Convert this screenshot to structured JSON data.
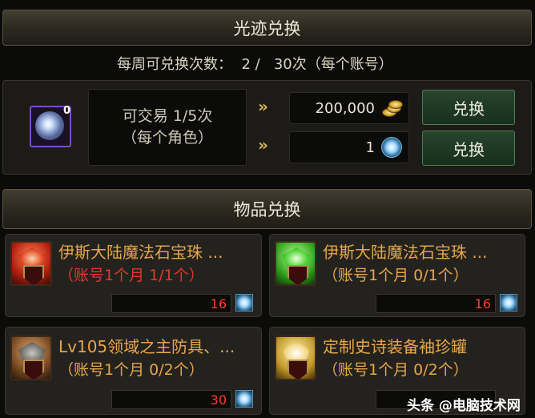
{
  "light_exchange": {
    "title": "光迹兑换",
    "weekly_limit": "每周可兑换次数：  2 /   30次（每个账号）",
    "item_badge": "0",
    "tradable_line1": "可交易 1/5次",
    "tradable_line2": "（每个角色）",
    "costs": [
      {
        "amount": "200,000",
        "currency_icon": "gold-coin-icon",
        "button": "兑换"
      },
      {
        "amount": "1",
        "currency_icon": "light-orb-icon",
        "button": "兑换"
      }
    ]
  },
  "item_exchange": {
    "title": "物品兑换",
    "items": [
      {
        "name": "伊斯大陆魔法石宝珠 ...",
        "limit": "（账号1个月 1/1个）",
        "limit_color": "#e0372f",
        "price": "16",
        "gem_color": "#d23a1e"
      },
      {
        "name": "伊斯大陆魔法石宝珠 ...",
        "limit": "（账号1个月 0/1个）",
        "limit_color": "#e6a64a",
        "price": "16",
        "gem_color": "#3fcf3a"
      },
      {
        "name": "Lv105领域之主防具、...",
        "limit": "（账号1个月 0/2个）",
        "limit_color": "#e6a64a",
        "price": "30",
        "gem_color": "#7d4b24"
      },
      {
        "name": "定制史诗装备袖珍罐",
        "limit": "（账号1个月 0/2个）",
        "limit_color": "#e6a64a",
        "price": "",
        "gem_color": "#c49a2a"
      }
    ]
  },
  "watermark": "头条 @电脑技术网"
}
